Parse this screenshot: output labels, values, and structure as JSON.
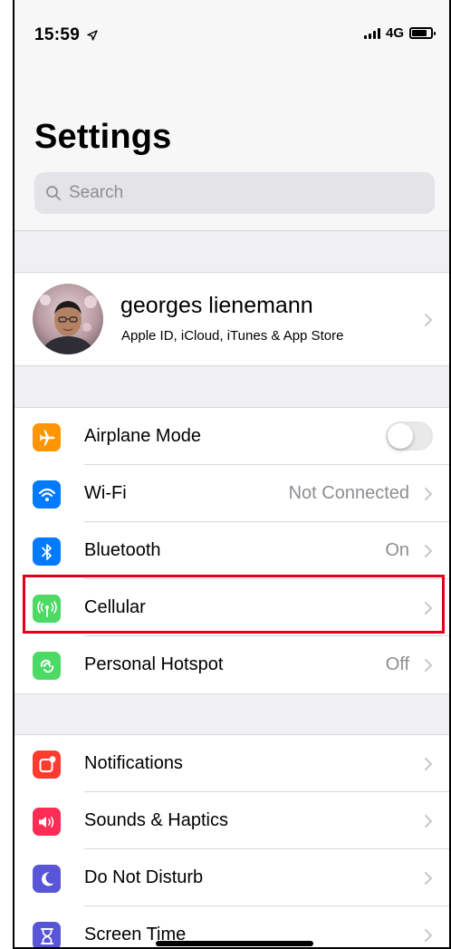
{
  "status_bar": {
    "time": "15:59",
    "network": "4G",
    "battery_level": 0.8
  },
  "header": {
    "title": "Settings",
    "search_placeholder": "Search"
  },
  "profile": {
    "name": "georges lienemann",
    "subtitle": "Apple ID, iCloud, iTunes & App Store"
  },
  "group_connectivity": [
    {
      "label": "Airplane Mode",
      "icon": "airplane-icon",
      "color": "#ff9500",
      "control": "toggle",
      "toggle_on": false
    },
    {
      "label": "Wi-Fi",
      "icon": "wifi-icon",
      "color": "#007aff",
      "value": "Not Connected"
    },
    {
      "label": "Bluetooth",
      "icon": "bluetooth-icon",
      "color": "#007aff",
      "value": "On"
    },
    {
      "label": "Cellular",
      "icon": "cellular-antenna-icon",
      "color": "#4cd964",
      "value": ""
    },
    {
      "label": "Personal Hotspot",
      "icon": "hotspot-icon",
      "color": "#4cd964",
      "value": "Off"
    }
  ],
  "group_notifications": [
    {
      "label": "Notifications",
      "icon": "notifications-icon",
      "color": "#ff3b30"
    },
    {
      "label": "Sounds & Haptics",
      "icon": "speaker-icon",
      "color": "#ff2d55"
    },
    {
      "label": "Do Not Disturb",
      "icon": "moon-icon",
      "color": "#5856d6"
    },
    {
      "label": "Screen Time",
      "icon": "hourglass-icon",
      "color": "#5856d6"
    }
  ],
  "highlight_color": "#e3001b"
}
